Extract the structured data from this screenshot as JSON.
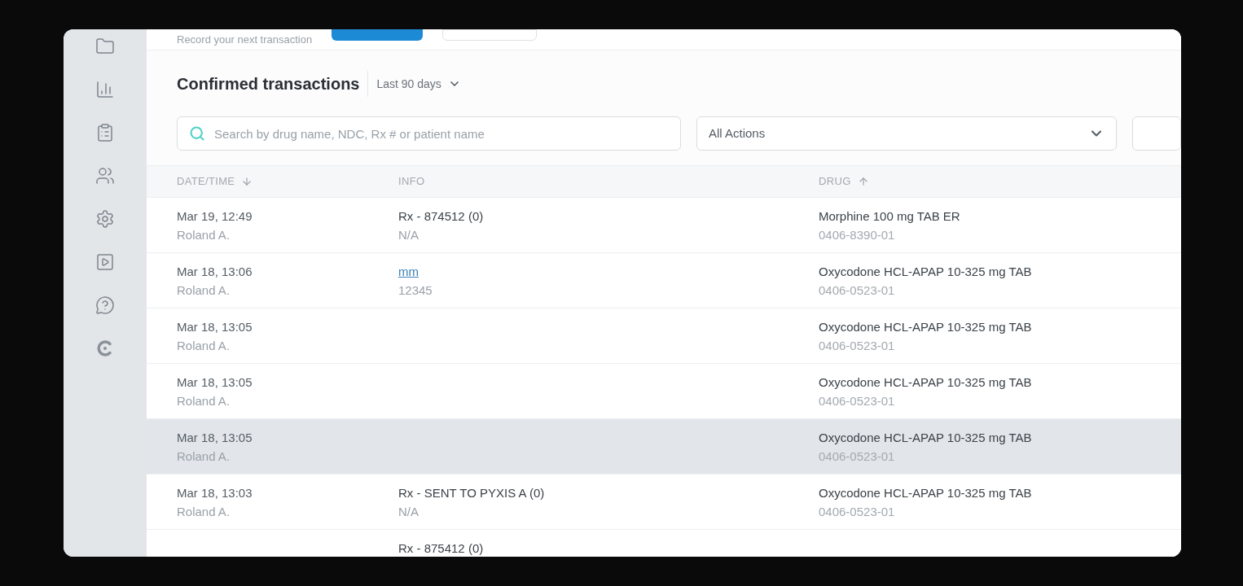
{
  "sidebar": {
    "items": [
      {
        "kind": "folder"
      },
      {
        "kind": "chart"
      },
      {
        "kind": "clipboard"
      },
      {
        "kind": "users"
      },
      {
        "kind": "settings"
      },
      {
        "kind": "video"
      },
      {
        "kind": "help"
      },
      {
        "kind": "logo"
      }
    ]
  },
  "top_bar": {
    "prompt": "Record your next transaction"
  },
  "header": {
    "title": "Confirmed transactions",
    "period": "Last 90 days"
  },
  "filters": {
    "search": {
      "placeholder": "Search by drug name, NDC, Rx # or patient name"
    },
    "actions": {
      "value": "All Actions"
    }
  },
  "table": {
    "columns": [
      {
        "label": "DATE/TIME",
        "kind": "descending"
      },
      {
        "label": "INFO",
        "kind": "plain"
      },
      {
        "label": "DRUG",
        "kind": "ascending"
      }
    ],
    "rows": [
      {
        "date": "Mar 19, 12:49",
        "user": "Roland A.",
        "info": {
          "kind": "text",
          "title": "Rx - 874512 (0)",
          "detail": "N/A"
        },
        "drug": "Morphine 100 mg TAB ER",
        "ndc": "0406-8390-01",
        "highlighted": false
      },
      {
        "date": "Mar 18, 13:06",
        "user": "Roland A.",
        "info": {
          "kind": "link",
          "title": "mm",
          "detail": "12345"
        },
        "drug": "Oxycodone HCL-APAP 10-325 mg TAB",
        "ndc": "0406-0523-01",
        "highlighted": false
      },
      {
        "date": "Mar 18, 13:05",
        "user": "Roland A.",
        "drug": "Oxycodone HCL-APAP 10-325 mg TAB",
        "ndc": "0406-0523-01",
        "highlighted": false
      },
      {
        "date": "Mar 18, 13:05",
        "user": "Roland A.",
        "drug": "Oxycodone HCL-APAP 10-325 mg TAB",
        "ndc": "0406-0523-01",
        "highlighted": false
      },
      {
        "date": "Mar 18, 13:05",
        "user": "Roland A.",
        "drug": "Oxycodone HCL-APAP 10-325 mg TAB",
        "ndc": "0406-0523-01",
        "highlighted": true
      },
      {
        "date": "Mar 18, 13:03",
        "user": "Roland A.",
        "info": {
          "kind": "text",
          "title": "Rx - SENT TO PYXIS A (0)",
          "detail": "N/A"
        },
        "drug": "Oxycodone HCL-APAP 10-325 mg TAB",
        "ndc": "0406-0523-01",
        "highlighted": false
      },
      {
        "info": {
          "kind": "text",
          "title": "Rx - 875412 (0)"
        },
        "highlighted": false
      }
    ]
  }
}
